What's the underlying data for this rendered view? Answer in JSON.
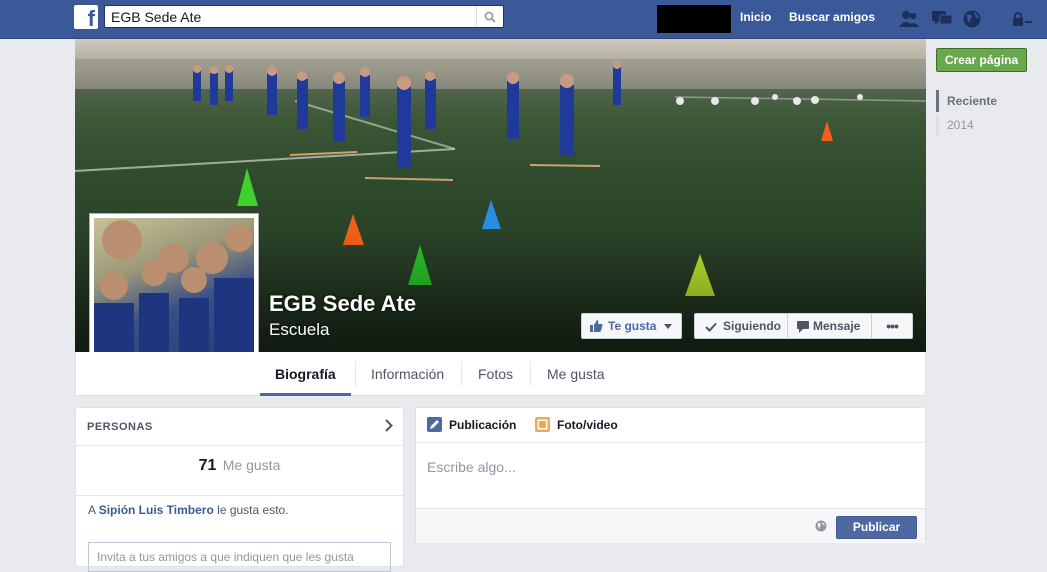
{
  "topbar": {
    "logo": "f",
    "search_value": "EGB Sede Ate",
    "nav_home": "Inicio",
    "nav_find_friends": "Buscar amigos",
    "icons": [
      "friend-requests-icon",
      "messages-icon",
      "notifications-globe-icon",
      "privacy-lock-icon"
    ]
  },
  "page": {
    "name": "EGB Sede Ate",
    "category": "Escuela",
    "like_button": "Te gusta",
    "following_button": "Siguiendo",
    "message_button": "Mensaje",
    "more_button": "•••"
  },
  "tabs": [
    "Biografía",
    "Información",
    "Fotos",
    "Me gusta"
  ],
  "right_column": {
    "create_page": "Crear página",
    "timeline": [
      "Reciente",
      "2014"
    ]
  },
  "people": {
    "title": "PERSONAS",
    "likes_count": "71",
    "likes_label": "Me gusta",
    "friend_prefix": "A",
    "friend_name": "Sipión Luis Timbero",
    "friend_suffix": "le gusta esto.",
    "invite_text": "Invita a tus amigos a que indiquen que les gusta"
  },
  "composer": {
    "tab_post": "Publicación",
    "tab_photo": "Foto/video",
    "placeholder": "Escribe algo...",
    "publish": "Publicar"
  },
  "colors": {
    "brand_blue": "#3b5998",
    "green_button": "#69a74e",
    "publish_blue": "#4e69a2"
  }
}
